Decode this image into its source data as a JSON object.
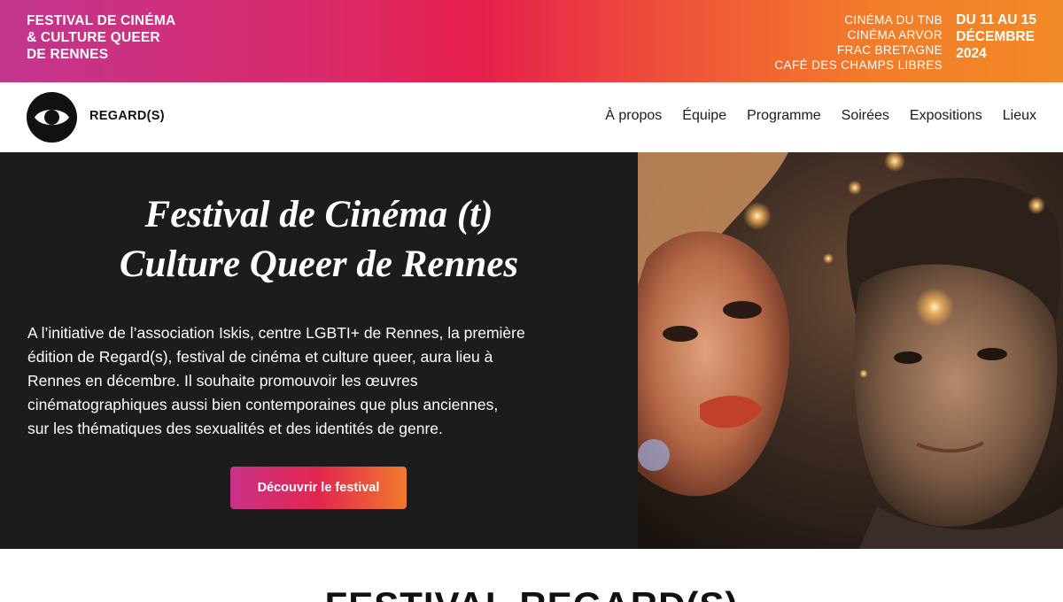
{
  "banner": {
    "festival_lines": [
      "FESTIVAL DE CINÉMA",
      "& CULTURE QUEER",
      "DE RENNES"
    ],
    "venues": [
      "CINÉMA DU TNB",
      "CINÉMA ARVOR",
      "FRAC BRETAGNE",
      "CAFÉ DES CHAMPS LIBRES"
    ],
    "dates": [
      "DU 11 AU 15",
      "DÉCEMBRE",
      "2024"
    ],
    "gradient_colors": [
      "#c2368f",
      "#e61f4c",
      "#f28a26"
    ]
  },
  "nav": {
    "logo_icon": "eye-icon",
    "brand": "REGARD(S)",
    "links": [
      "À propos",
      "Équipe",
      "Programme",
      "Soirées",
      "Expositions",
      "Lieux"
    ]
  },
  "hero": {
    "title_lines": [
      "Festival de Cinéma (t)",
      "Culture Queer de Rennes"
    ],
    "description_lines": [
      "A l’initiative de l’association Iskis, centre LGBTI+ de Rennes, la première",
      "édition de Regard(s), festival de cinéma et culture queer, aura lieu à",
      "Rennes en décembre. Il souhaite promouvoir les œuvres",
      "cinématographiques aussi bien contemporaines que plus anciennes,",
      "sur les thématiques des sexualités et des identités de genre."
    ],
    "cta_label": "Découvrir le festival",
    "background_color": "#1c1c1c"
  },
  "section": {
    "heading": "FESTIVAL REGARD(S)"
  }
}
